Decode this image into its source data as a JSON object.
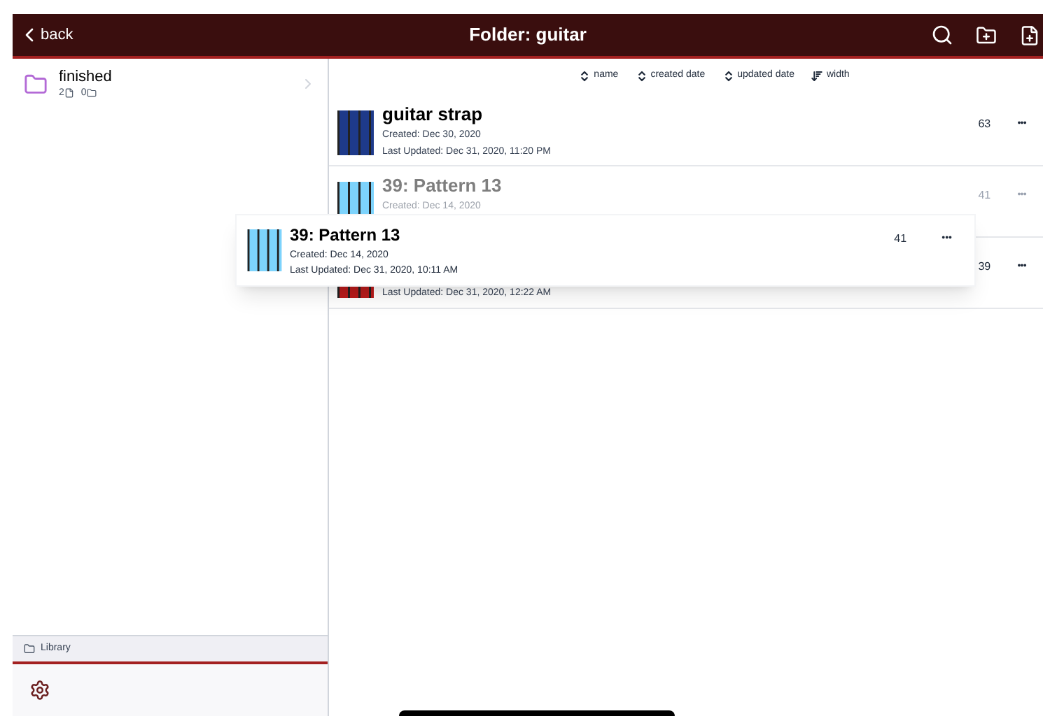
{
  "header": {
    "back": "back",
    "title": "Folder: guitar"
  },
  "sidebar": {
    "folders": [
      {
        "name": "finished",
        "files": "2",
        "subfolders": "0"
      }
    ],
    "footer": {
      "label": "Library"
    }
  },
  "sort": [
    {
      "label": "name",
      "kind": "both"
    },
    {
      "label": "created date",
      "kind": "both"
    },
    {
      "label": "updated date",
      "kind": "both"
    },
    {
      "label": "width",
      "kind": "desc"
    }
  ],
  "patterns": [
    {
      "title": "guitar strap",
      "created": "Created: Dec 30, 2020",
      "updated": "Last Updated: Dec 31, 2020, 11:20 PM",
      "count": "63",
      "more": "•••",
      "color": "#1e3a8a",
      "dragging": false
    },
    {
      "title": "39: Pattern 13",
      "created": "Created: Dec 14, 2020",
      "count": "41",
      "more": "•••",
      "color": "#7dd3fc",
      "dragging": true
    },
    {
      "updated": "Last Updated: Dec 31, 2020, 12:22 AM",
      "count": "39",
      "more": "•••",
      "color": "#b91c1c",
      "dragging": false
    }
  ],
  "drag_card": {
    "title": "39: Pattern 13",
    "created": "Created: Dec 14, 2020",
    "updated": "Last Updated: Dec 31, 2020, 10:11 AM",
    "count": "41",
    "more": "•••",
    "color": "#7dd3fc"
  }
}
